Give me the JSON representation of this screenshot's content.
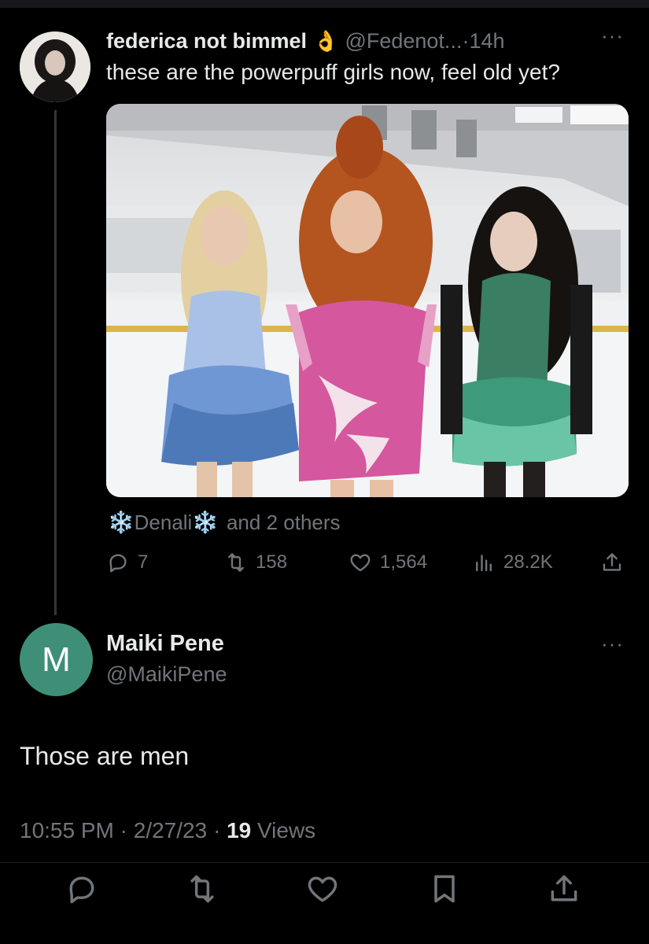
{
  "tweet": {
    "author_name": "federica not bimmel",
    "author_emoji": "👌",
    "handle": "@Fedenot...",
    "separator": "·",
    "time": "14h",
    "more": "···",
    "text": "these are the powerpuff girls now, feel old yet?",
    "mentions": {
      "snow": "❄️",
      "name": "Denali",
      "rest": "and 2 others"
    },
    "stats": {
      "replies": "7",
      "retweets": "158",
      "likes": "1,564",
      "views": "28.2K"
    },
    "media": {
      "dress_colors": [
        "#6f97d3",
        "#d5579d",
        "#3d9a7a"
      ],
      "hair_colors": [
        "#e3cfa0",
        "#b4541f",
        "#15120f"
      ]
    }
  },
  "reply": {
    "avatar_letter": "M",
    "avatar_color": "#3f8f78",
    "author_name": "Maiki Pene",
    "handle": "@MaikiPene",
    "more": "···",
    "text": "Those are men",
    "time": "10:55 PM",
    "sep1": "·",
    "date": "2/27/23",
    "sep2": "·",
    "views_count": "19",
    "views_label": "Views"
  },
  "colors": {
    "background": "#000000",
    "text_primary": "#e7e9ea",
    "text_secondary": "#71767b"
  }
}
